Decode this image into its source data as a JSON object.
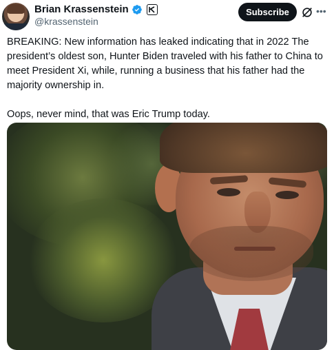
{
  "author": {
    "display_name": "Brian Krassenstein",
    "handle": "@krassenstein",
    "verified": true
  },
  "actions": {
    "subscribe_label": "Subscribe",
    "grok_icon": "grok-icon",
    "more_icon": "more-icon"
  },
  "tweet": {
    "paragraph1": "BREAKING: New information has leaked indicating that in 2022 The president’s oldest son, Hunter Biden traveled with his father to China to meet President Xi, while, running a business that his father had the majority ownership in.",
    "paragraph2": "Oops, never mind, that was Eric Trump today."
  },
  "colors": {
    "verified": "#1d9bf0",
    "subscribe_bg": "#0f1419",
    "text": "#0f1419",
    "secondary": "#536471"
  }
}
